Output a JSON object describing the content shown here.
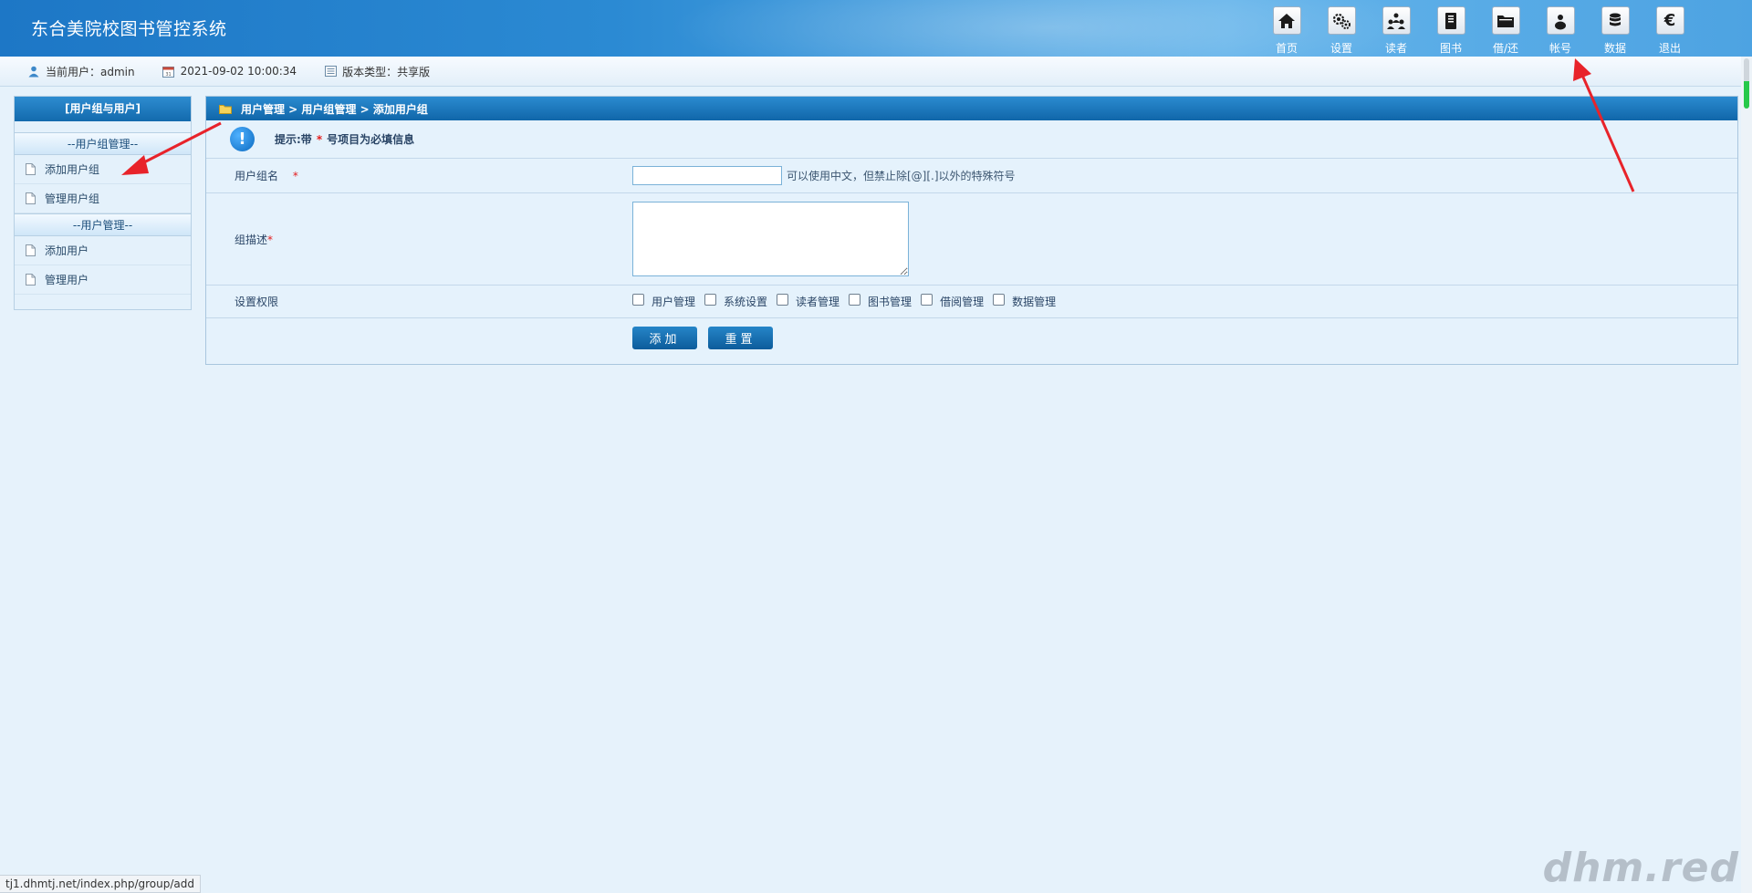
{
  "header": {
    "app_title": "东合美院校图书管控系统",
    "nav": [
      {
        "label": "首页",
        "icon": "home-icon"
      },
      {
        "label": "设置",
        "icon": "gears-icon"
      },
      {
        "label": "读者",
        "icon": "readers-icon"
      },
      {
        "label": "图书",
        "icon": "book-icon"
      },
      {
        "label": "借/还",
        "icon": "folder-icon"
      },
      {
        "label": "帐号",
        "icon": "account-icon"
      },
      {
        "label": "数据",
        "icon": "database-icon"
      },
      {
        "label": "退出",
        "icon": "euro-icon"
      }
    ]
  },
  "infobar": {
    "current_user": "当前用户：admin",
    "datetime": "2021-09-02 10:00:34",
    "version": "版本类型：共享版"
  },
  "sidebar": {
    "title": "[用户组与用户]",
    "sections": [
      {
        "heading": "--用户组管理--",
        "items": [
          "添加用户组",
          "管理用户组"
        ]
      },
      {
        "heading": "--用户管理--",
        "items": [
          "添加用户",
          "管理用户"
        ]
      }
    ]
  },
  "main": {
    "breadcrumb": "用户管理 > 用户组管理 > 添加用户组",
    "tip_prefix": "提示:带",
    "tip_star": "*",
    "tip_suffix": "号项目为必填信息",
    "group_name_label": "用户组名",
    "required_mark": "*",
    "group_name_value": "",
    "group_name_hint": "可以使用中文，但禁止除[@][.]以外的特殊符号",
    "description_label": "组描述",
    "description_value": "",
    "permissions_label": "设置权限",
    "permissions": [
      "用户管理",
      "系统设置",
      "读者管理",
      "图书管理",
      "借阅管理",
      "数据管理"
    ],
    "add_button": "添加",
    "reset_button": "重置"
  },
  "status_url": "tj1.dhmtj.net/index.php/group/add",
  "watermark": "dhm.red",
  "colors": {
    "header_blue": "#1d77c6",
    "bar_blue": "#136aad",
    "required_red": "#e41d1d",
    "annotation_arrow": "#e8232a"
  }
}
